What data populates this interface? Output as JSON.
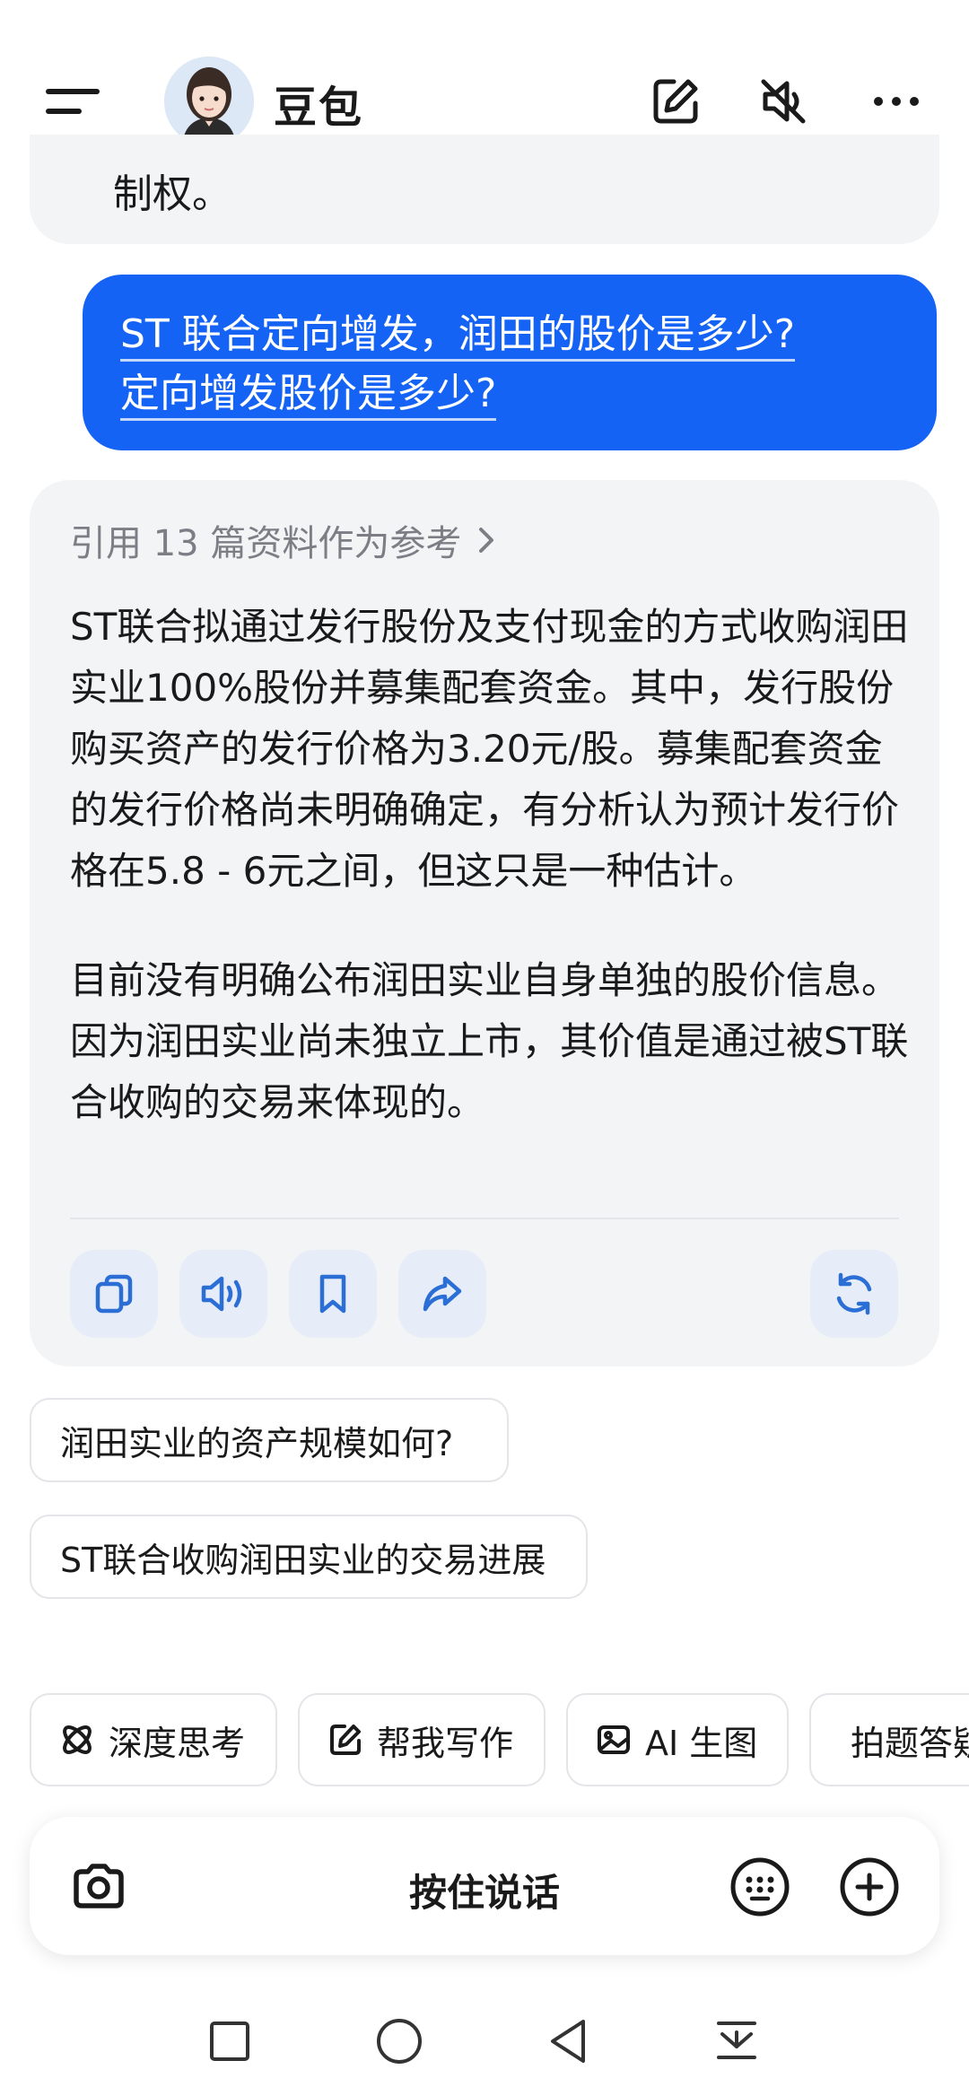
{
  "header": {
    "title": "豆包",
    "menu_icon": "menu-icon",
    "edit_icon": "edit-icon",
    "mute_icon": "speaker-muted-icon",
    "more_icon": "more-icon"
  },
  "previous_message": {
    "tail_text": "制权。"
  },
  "user_message": {
    "line1": "ST 联合定向增发，润田的股价是多少?",
    "line2": "定向增发股价是多少?"
  },
  "answer": {
    "reference_label": "引用 13 篇资料作为参考",
    "paragraphs": [
      "ST联合拟通过发行股份及支付现金的方式收购润田实业100%股份并募集配套资金。其中，发行股份购买资产的发行价格为3.20元/股。募集配套资金的发行价格尚未明确确定，有分析认为预计发行价格在5.8 - 6元之间，但这只是一种估计。",
      "目前没有明确公布润田实业自身单独的股价信息。因为润田实业尚未独立上市，其价值是通过被ST联合收购的交易来体现的。"
    ],
    "actions": [
      "copy-icon",
      "read-aloud-icon",
      "bookmark-icon",
      "share-icon",
      "regenerate-icon"
    ]
  },
  "suggestions": [
    "润田实业的资产规模如何?",
    "ST联合收购润田实业的交易进展"
  ],
  "tools": [
    {
      "label": "深度思考",
      "icon": "deep-think-icon"
    },
    {
      "label": "帮我写作",
      "icon": "write-icon"
    },
    {
      "label": "AI 生图",
      "icon": "image-icon"
    },
    {
      "label": "拍题答疑",
      "icon": "photo-question-icon"
    }
  ],
  "input_bar": {
    "hold_to_talk": "按住说话"
  },
  "colors": {
    "accent": "#1463f5",
    "card_bg": "#f3f4f6",
    "action_bg": "#e6edf8"
  }
}
